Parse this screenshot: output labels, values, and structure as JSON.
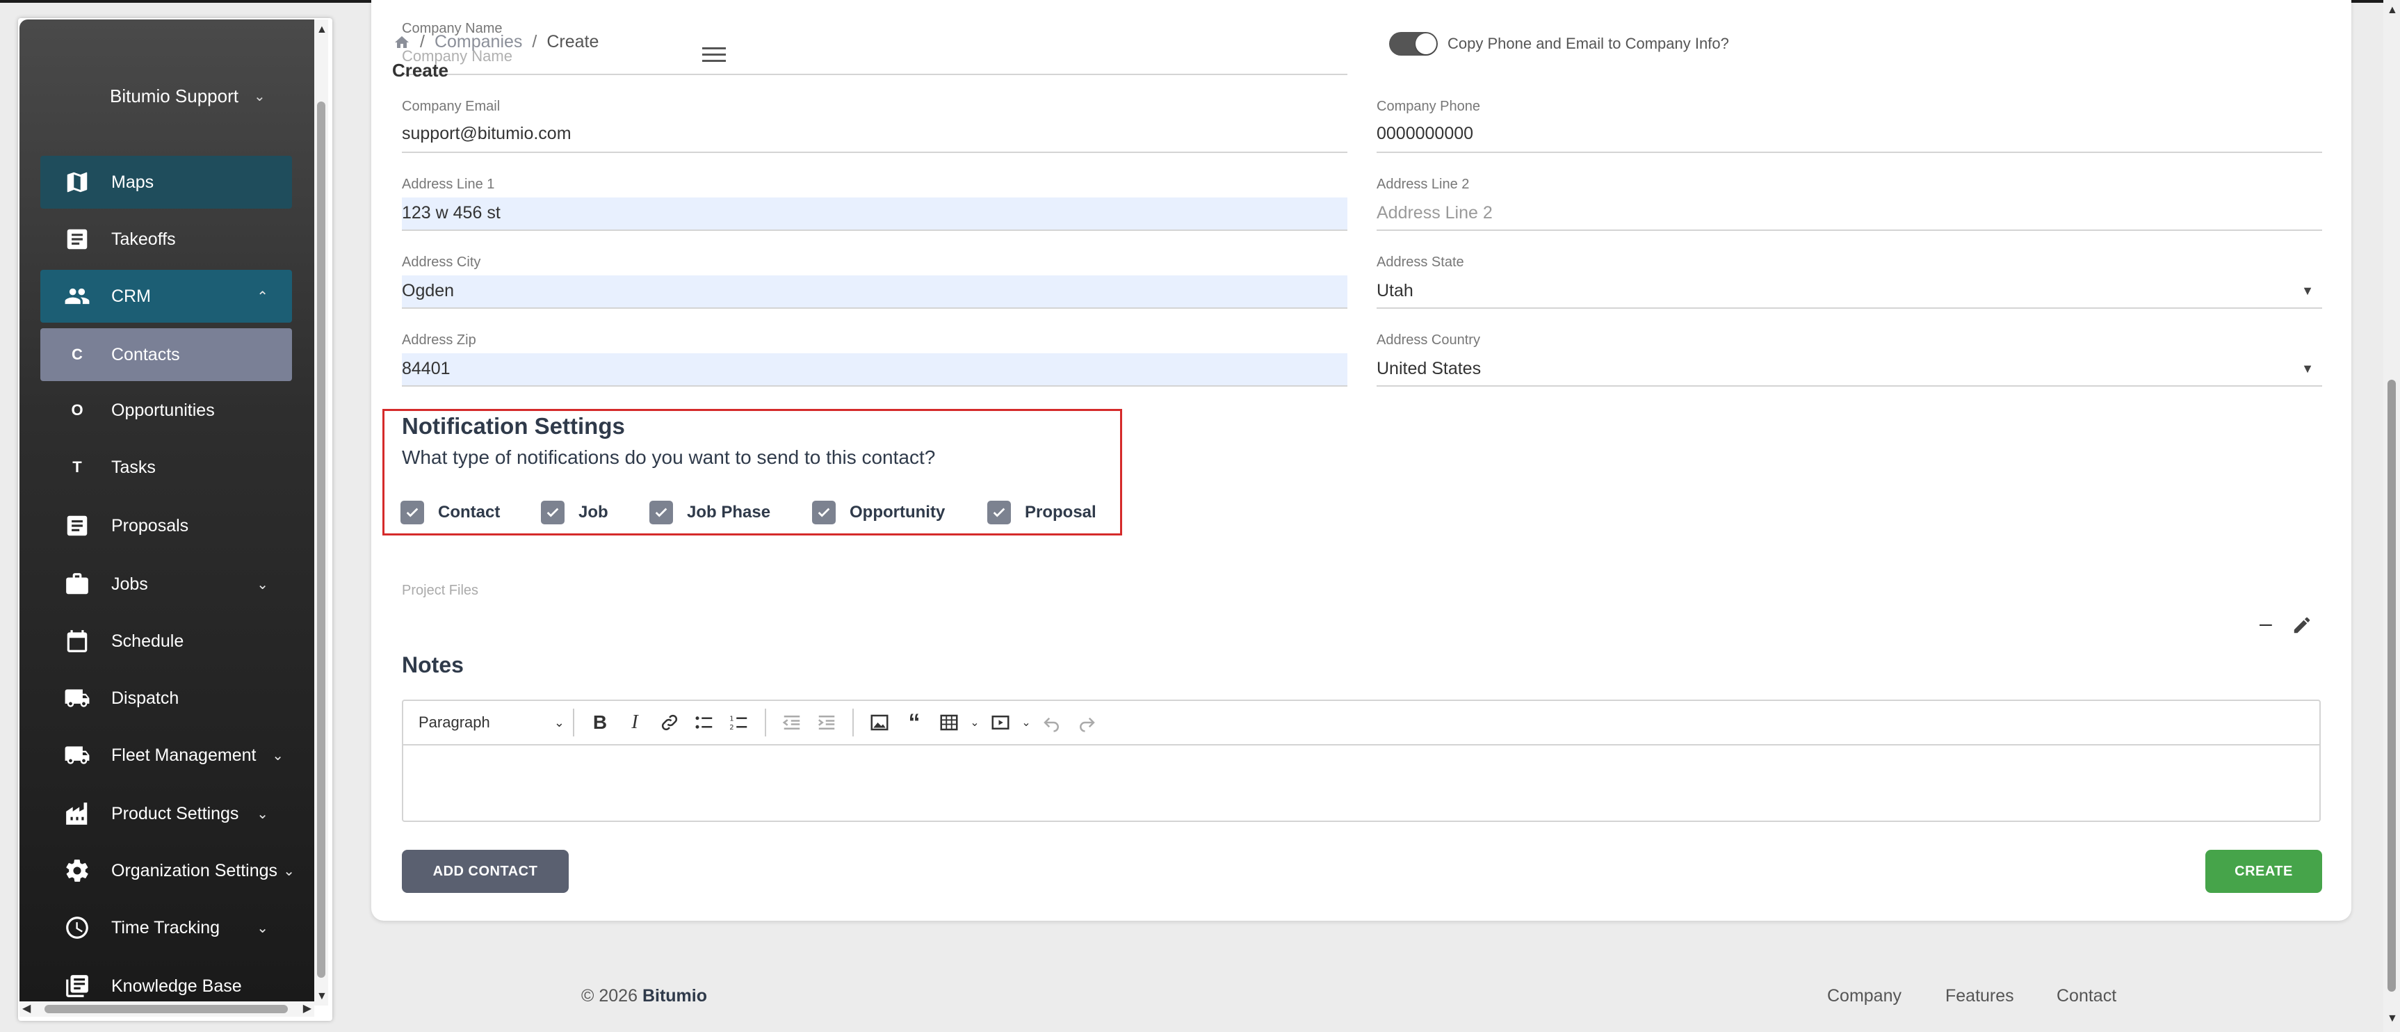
{
  "sidebar": {
    "org": "Bitumio Support",
    "items": [
      {
        "label": "Maps",
        "icon": "map-icon"
      },
      {
        "label": "Takeoffs",
        "icon": "document-icon"
      },
      {
        "label": "CRM",
        "icon": "people-icon"
      },
      {
        "label": "Contacts",
        "letter": "C"
      },
      {
        "label": "Opportunities",
        "letter": "O"
      },
      {
        "label": "Tasks",
        "letter": "T"
      },
      {
        "label": "Proposals",
        "icon": "document-icon"
      },
      {
        "label": "Jobs",
        "icon": "briefcase-icon"
      },
      {
        "label": "Schedule",
        "icon": "calendar-icon"
      },
      {
        "label": "Dispatch",
        "icon": "truck-icon"
      },
      {
        "label": "Fleet Management",
        "icon": "truck-icon"
      },
      {
        "label": "Product Settings",
        "icon": "factory-icon"
      },
      {
        "label": "Organization Settings",
        "icon": "gear-icon"
      },
      {
        "label": "Time Tracking",
        "icon": "clock-icon"
      },
      {
        "label": "Knowledge Base",
        "icon": "book-icon"
      }
    ]
  },
  "header": {
    "crumb_companies": "Companies",
    "crumb_create": "Create",
    "title": "Create"
  },
  "form": {
    "company_name": {
      "label": "Company Name",
      "placeholder": "Company Name"
    },
    "copy_toggle_label": "Copy Phone and Email to Company Info?",
    "company_email": {
      "label": "Company Email",
      "value": "support@bitumio.com"
    },
    "company_phone": {
      "label": "Company Phone",
      "value": "0000000000"
    },
    "address1": {
      "label": "Address Line 1",
      "value": "123 w 456 st"
    },
    "address2": {
      "label": "Address Line 2",
      "placeholder": "Address Line 2"
    },
    "city": {
      "label": "Address City",
      "value": "Ogden"
    },
    "state": {
      "label": "Address State",
      "value": "Utah"
    },
    "zip": {
      "label": "Address Zip",
      "value": "84401"
    },
    "country": {
      "label": "Address Country",
      "value": "United States"
    }
  },
  "notifications": {
    "title": "Notification Settings",
    "question": "What type of notifications do you want to send to this contact?",
    "options": [
      "Contact",
      "Job",
      "Job Phase",
      "Opportunity",
      "Proposal"
    ]
  },
  "files": {
    "label": "Project Files"
  },
  "notes": {
    "title": "Notes",
    "block_style": "Paragraph"
  },
  "buttons": {
    "add_contact": "ADD CONTACT",
    "create": "CREATE"
  },
  "footer": {
    "copyright": "© 2026",
    "brand": "Bitumio",
    "links": [
      "Company",
      "Features",
      "Contact"
    ]
  },
  "colors": {
    "accent_teal": "#1c5e74",
    "create_green": "#46a44a",
    "highlight_red": "#d52b2b"
  }
}
